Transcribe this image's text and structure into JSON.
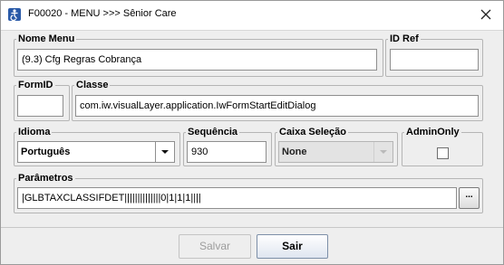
{
  "window": {
    "title": "F00020 - MENU >>> Sênior Care",
    "app_icon": "accessibility-icon",
    "close_icon": "close-icon"
  },
  "fields": {
    "nome_menu": {
      "label": "Nome Menu",
      "value": "(9.3) Cfg Regras Cobrança"
    },
    "id_ref": {
      "label": "ID Ref",
      "value": ""
    },
    "form_id": {
      "label": "FormID",
      "value": ""
    },
    "classe": {
      "label": "Classe",
      "value": "com.iw.visualLayer.application.IwFormStartEditDialog"
    },
    "idioma": {
      "label": "Idioma",
      "value": "Português"
    },
    "sequencia": {
      "label": "Sequência",
      "value": "930"
    },
    "caixa_selecao": {
      "label": "Caixa Seleção",
      "value": "None"
    },
    "admin_only": {
      "label": "AdminOnly",
      "checked": false
    },
    "parametros": {
      "label": "Parâmetros",
      "value": "|GLBTAXCLASSIFDET||||||||||||||0|1|1|1||||",
      "button_label": "..."
    }
  },
  "buttons": {
    "salvar": "Salvar",
    "sair": "Sair"
  },
  "colors": {
    "window_bg": "#eeeeee",
    "border": "#b5b5b5",
    "primary_button_tint": "#dfe6f0"
  }
}
